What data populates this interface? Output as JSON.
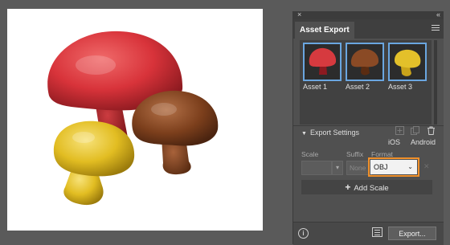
{
  "panel": {
    "title": "Asset Export",
    "close_glyph": "×",
    "collapse_glyph": "«"
  },
  "assets": [
    {
      "label": "Asset 1",
      "color": "#d63a3f"
    },
    {
      "label": "Asset 2",
      "color": "#8a4a25"
    },
    {
      "label": "Asset 3",
      "color": "#e3c02a"
    }
  ],
  "export_settings": {
    "title": "Export Settings",
    "ios_label": "iOS",
    "android_label": "Android",
    "columns": {
      "scale": "Scale",
      "suffix": "Suffix",
      "format": "Format"
    },
    "suffix_placeholder": "None",
    "format_value": "OBJ",
    "add_scale_label": "Add Scale"
  },
  "bottom": {
    "info_glyph": "i",
    "export_label": "Export..."
  },
  "colors": {
    "accent_highlight": "#f0902a",
    "selection_border": "#6aa6e0"
  },
  "icons": [
    "close-icon",
    "collapse-icon",
    "panel-menu-icon",
    "disclosure-triangle-icon",
    "add-icon",
    "duplicate-icon",
    "trash-icon",
    "chevron-down-icon",
    "info-icon",
    "list-icon"
  ]
}
